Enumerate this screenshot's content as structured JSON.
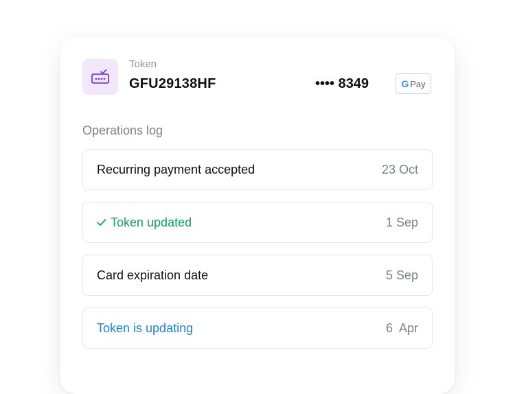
{
  "token": {
    "label": "Token",
    "value": "GFU29138HF",
    "card_masked": "•••• 8349",
    "wallet": {
      "brand_letter": "G",
      "label": "Pay"
    },
    "icon": "card-check-icon",
    "icon_color": "#7c3aed",
    "icon_bg": "#f1e8fd"
  },
  "operations_log": {
    "title": "Operations log",
    "items": [
      {
        "label": "Recurring payment accepted",
        "date": "23 Oct",
        "status": "default"
      },
      {
        "label": "Token updated",
        "date": "1 Sep",
        "status": "success",
        "icon": "check-icon"
      },
      {
        "label": "Card expiration date",
        "date": "5 Sep",
        "status": "default"
      },
      {
        "label": "Token is updating",
        "date": "6  Apr",
        "status": "info"
      }
    ]
  },
  "colors": {
    "success": "#17a06a",
    "info": "#1e83d2",
    "muted": "#7d8085",
    "border": "#e6e7e9"
  }
}
